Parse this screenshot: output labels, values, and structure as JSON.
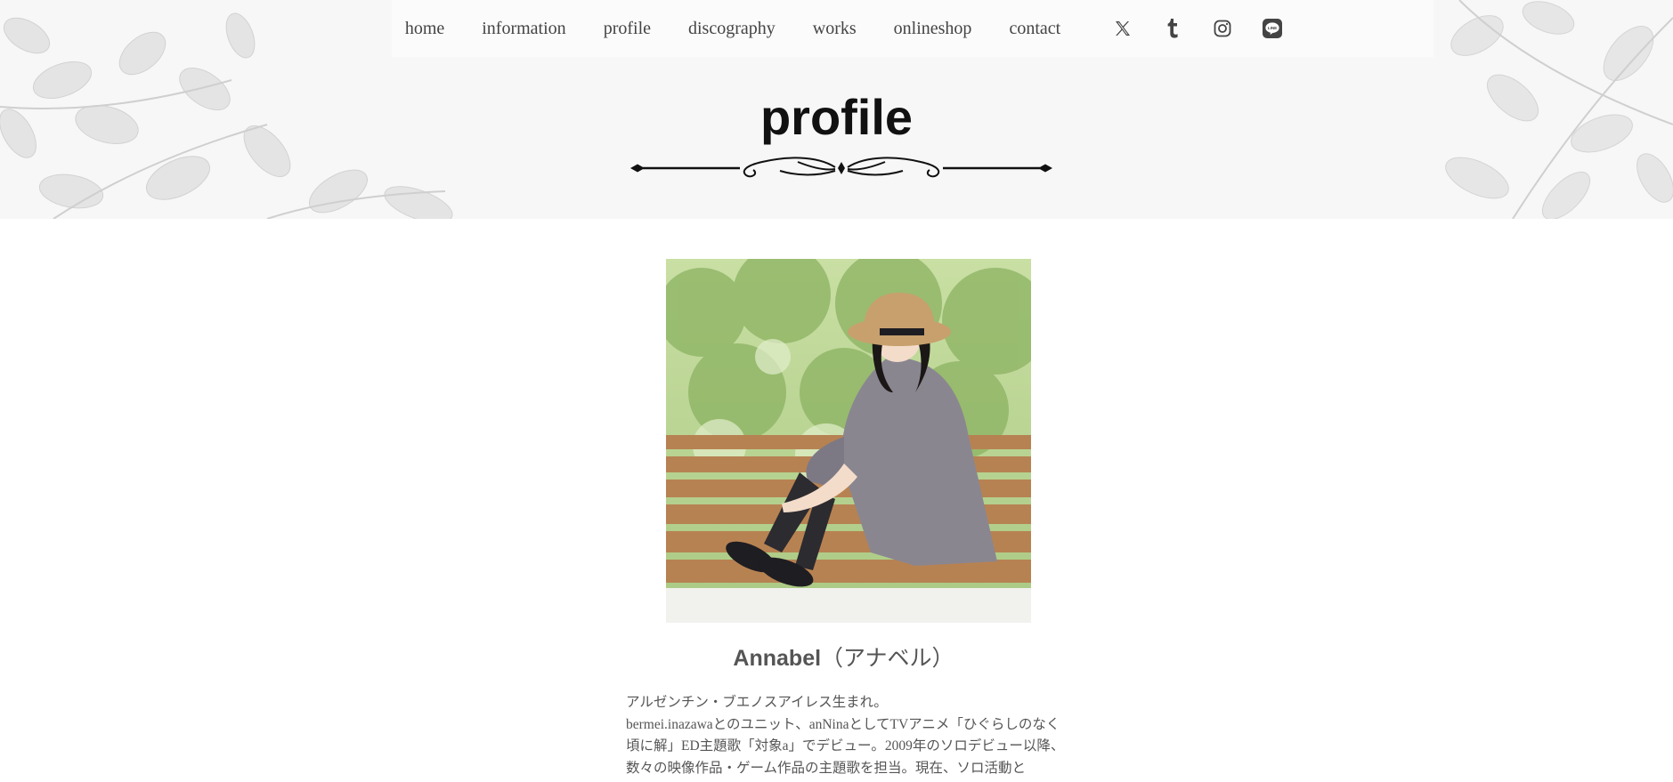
{
  "nav": {
    "links": [
      "home",
      "information",
      "profile",
      "discography",
      "works",
      "onlineshop",
      "contact"
    ],
    "social": [
      "x-icon",
      "tumblr-icon",
      "instagram-icon",
      "line-icon"
    ]
  },
  "page": {
    "title": "profile"
  },
  "artist": {
    "name_latin": "Annabel",
    "name_kana": "（アナベル）",
    "bio_lines": [
      "アルゼンチン・ブエノスアイレス生まれ。",
      "bermei.inazawaとのユニット、anNinaとしてTVアニメ「ひぐらしのなく頃に解」ED主題歌「対象a」でデビュー。2009年のソロデビュー以降、数々の映像作品・ゲーム作品の主題歌を担当。現在、ソロ活動と"
    ]
  },
  "colors": {
    "text": "#555555",
    "title": "#111111",
    "header_bg": "#f7f7f7"
  }
}
